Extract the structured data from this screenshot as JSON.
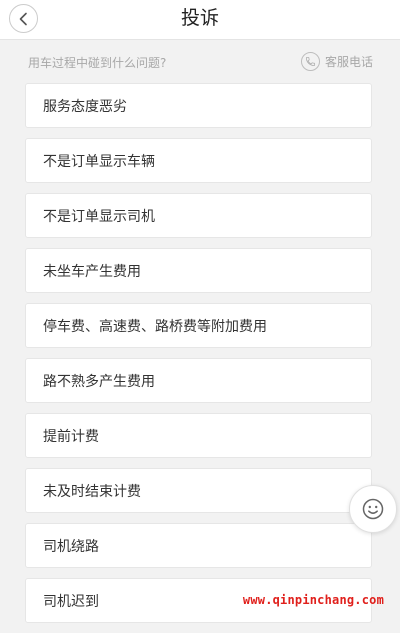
{
  "header": {
    "title": "投诉",
    "back_icon": "chevron-left-icon"
  },
  "subbar": {
    "question": "用车过程中碰到什么问题?",
    "service_label": "客服电话",
    "service_icon": "phone-icon"
  },
  "complaints": [
    {
      "label": "服务态度恶劣"
    },
    {
      "label": "不是订单显示车辆"
    },
    {
      "label": "不是订单显示司机"
    },
    {
      "label": "未坐车产生费用"
    },
    {
      "label": "停车费、高速费、路桥费等附加费用"
    },
    {
      "label": "路不熟多产生费用"
    },
    {
      "label": "提前计费"
    },
    {
      "label": "未及时结束计费"
    },
    {
      "label": "司机绕路"
    },
    {
      "label": "司机迟到"
    }
  ],
  "floating": {
    "icon": "smiley-face-icon"
  },
  "watermark": {
    "text": "www.qinpinchang.com"
  },
  "colors": {
    "background": "#f2f2f2",
    "card": "#ffffff",
    "watermark": "#e0201c",
    "muted_text": "#a8a8a8"
  }
}
